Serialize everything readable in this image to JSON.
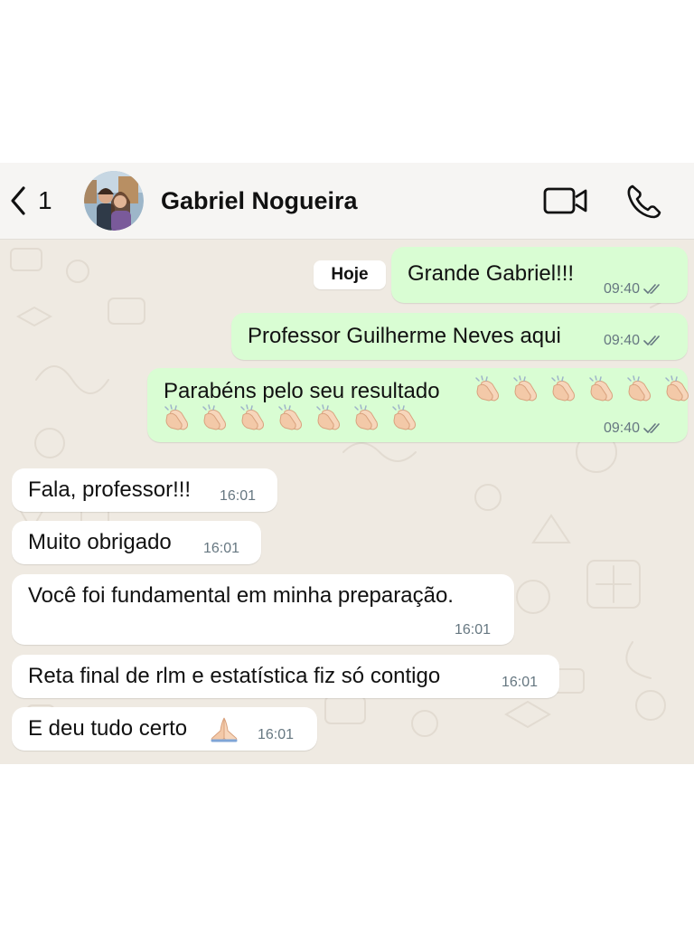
{
  "header": {
    "back_count": "1",
    "contact_name": "Gabriel Nogueira"
  },
  "date_chip": "Hoje",
  "messages": [
    {
      "direction": "outgoing",
      "text": "Grande Gabriel!!!",
      "time": "09:40",
      "status": "read"
    },
    {
      "direction": "outgoing",
      "text": "Professor Guilherme Neves aqui",
      "time": "09:40",
      "status": "read"
    },
    {
      "direction": "outgoing",
      "text": "Parabéns pelo seu resultado",
      "emoji": "clapping-hands",
      "emoji_count": 13,
      "time": "09:40",
      "status": "read"
    },
    {
      "direction": "incoming",
      "text": "Fala, professor!!!",
      "time": "16:01"
    },
    {
      "direction": "incoming",
      "text": "Muito obrigado",
      "time": "16:01"
    },
    {
      "direction": "incoming",
      "text": "Você foi fundamental em minha preparação.",
      "time": "16:01"
    },
    {
      "direction": "incoming",
      "text": "Reta final de rlm e estatística fiz só contigo",
      "time": "16:01"
    },
    {
      "direction": "incoming",
      "text": "E deu tudo certo",
      "emoji": "folded-hands",
      "time": "16:01"
    }
  ],
  "icons": {
    "back": "chevron-left-icon",
    "video": "video-camera-icon",
    "phone": "phone-icon",
    "read_status": "double-check-icon"
  },
  "colors": {
    "outgoing_bubble": "#d9fdd3",
    "incoming_bubble": "#ffffff",
    "chat_background": "#efeae2",
    "header_background": "#f6f5f3",
    "read_ticks": "#667781",
    "timestamp": "#667781"
  }
}
